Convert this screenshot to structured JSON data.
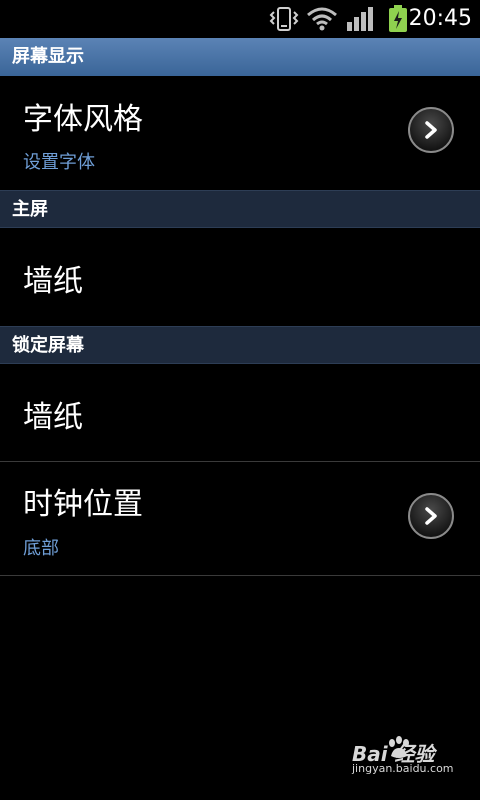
{
  "status_bar": {
    "time": "20:45",
    "icons": [
      "vibrate-icon",
      "wifi-icon",
      "signal-icon",
      "battery-charging-icon"
    ],
    "battery_color": "#8fd14f"
  },
  "sections": {
    "display": {
      "header": "屏幕显示",
      "font_style": {
        "title": "字体风格",
        "subtitle": "设置字体"
      }
    },
    "home": {
      "header": "主屏",
      "wallpaper": {
        "title": "墙纸"
      }
    },
    "lock": {
      "header": "锁定屏幕",
      "wallpaper": {
        "title": "墙纸"
      },
      "clock_position": {
        "title": "时钟位置",
        "subtitle": "底部"
      }
    }
  },
  "watermark": {
    "logo_text": "Bai  经验",
    "url": "jingyan.baidu.com"
  },
  "colors": {
    "header_accent": "#4a74a8",
    "subtitle": "#6f9ed6",
    "header_dark": "#1e2a3d"
  }
}
